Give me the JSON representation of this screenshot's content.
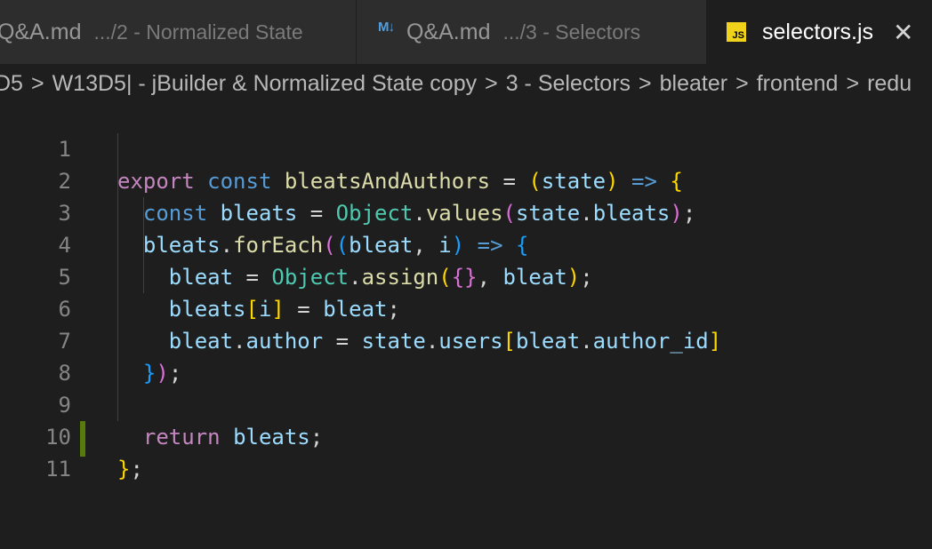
{
  "tabs": [
    {
      "name": "Q&A.md",
      "description": ".../2 - Normalized State",
      "icon": "markdown-icon",
      "active": false
    },
    {
      "name": "Q&A.md",
      "description": ".../3 - Selectors",
      "icon": "markdown-icon",
      "icon_text": "M↓",
      "active": false
    },
    {
      "name": "selectors.js",
      "icon": "javascript-icon",
      "icon_text": "JS",
      "active": true,
      "close_glyph": "✕"
    }
  ],
  "breadcrumb": {
    "separator": ">",
    "items": [
      "D5",
      "W13D5| - jBuilder & Normalized State copy",
      "3 - Selectors",
      "bleater",
      "frontend",
      "redu"
    ]
  },
  "editor": {
    "line_numbers": [
      "1",
      "2",
      "3",
      "4",
      "5",
      "6",
      "7",
      "8",
      "9",
      "10",
      "11"
    ],
    "lines": [
      "export const bleatsAndAuthors = (state) => {",
      "  const bleats = Object.values(state.bleats);",
      "  bleats.forEach((bleat, i) => {",
      "    bleat = Object.assign({}, bleat);",
      "    bleats[i] = bleat;",
      "    bleat.author = state.users[bleat.author_id]",
      "  });",
      "",
      "  return bleats;",
      "};",
      ""
    ]
  },
  "colors": {
    "keyword": "#c586c0",
    "storage": "#569cd6",
    "function": "#dcdcaa",
    "variable": "#9cdcfe",
    "class": "#4ec9b0",
    "bracket_gold": "#ffd700",
    "bracket_orchid": "#da70d6",
    "bracket_blue": "#179fff",
    "git_added": "#587c0c",
    "js_badge": "#f0d21b"
  }
}
